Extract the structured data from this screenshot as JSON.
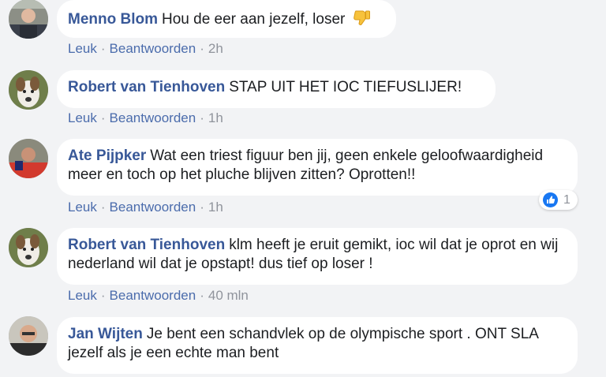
{
  "actions": {
    "like": "Leuk",
    "reply": "Beantwoorden",
    "separator": "·"
  },
  "comments": [
    {
      "author": "Menno Blom",
      "text": "Hou de eer aan jezelf, loser",
      "emoji": "thumbs-down-emoji",
      "time": "2h",
      "avatar": "avatar-man-dark-clothes"
    },
    {
      "author": "Robert van Tienhoven",
      "text": "STAP UIT HET IOC TIEFUSLIJER!",
      "time": "1h",
      "avatar": "avatar-dog"
    },
    {
      "author": "Ate Pijpker",
      "text": "Wat een triest figuur ben jij, geen enkele geloofwaardigheid meer en toch op het pluche blijven zitten? Oprotten!!",
      "time": "1h",
      "avatar": "avatar-man-red-shirt",
      "reaction": {
        "icon": "like-icon",
        "count": "1"
      }
    },
    {
      "author": "Robert van Tienhoven",
      "text": "klm heeft je eruit gemikt, ioc wil dat je oprot en wij nederland wil dat je opstapt! dus tief op loser !",
      "time": "40 mln",
      "avatar": "avatar-dog"
    },
    {
      "author": "Jan Wijten",
      "text": "Je bent een schandvlek op de olympische sport . ONT SLA jezelf als je een echte man bent",
      "avatar": "avatar-older-man"
    }
  ],
  "colors": {
    "background": "#f2f3f5",
    "author": "#385898",
    "link": "#4b6cac",
    "meta": "#90949c",
    "like_blue": "#1877f2"
  }
}
